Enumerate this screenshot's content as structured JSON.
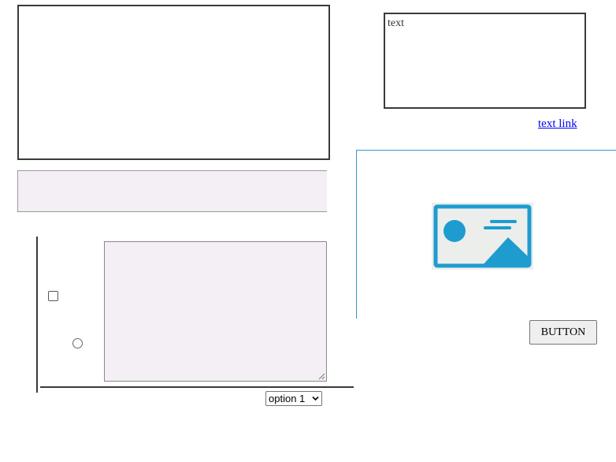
{
  "text_box": {
    "value": "text"
  },
  "link": {
    "label": "text link"
  },
  "select": {
    "selected": "option 1"
  },
  "button": {
    "label": "BUTTON"
  },
  "checkbox": {
    "checked": false
  },
  "radio": {
    "checked": false
  },
  "icons": {
    "image_placeholder": "image-placeholder-icon",
    "select_chevron": "chevron-down-icon",
    "resize_grip": "resize-grip-icon"
  },
  "colors": {
    "image_icon_blue": "#1e9ccf",
    "image_icon_bg": "#eceeec",
    "input_fill": "#f3eff4",
    "link": "#0000ee",
    "frame_accent": "#3399cc"
  }
}
